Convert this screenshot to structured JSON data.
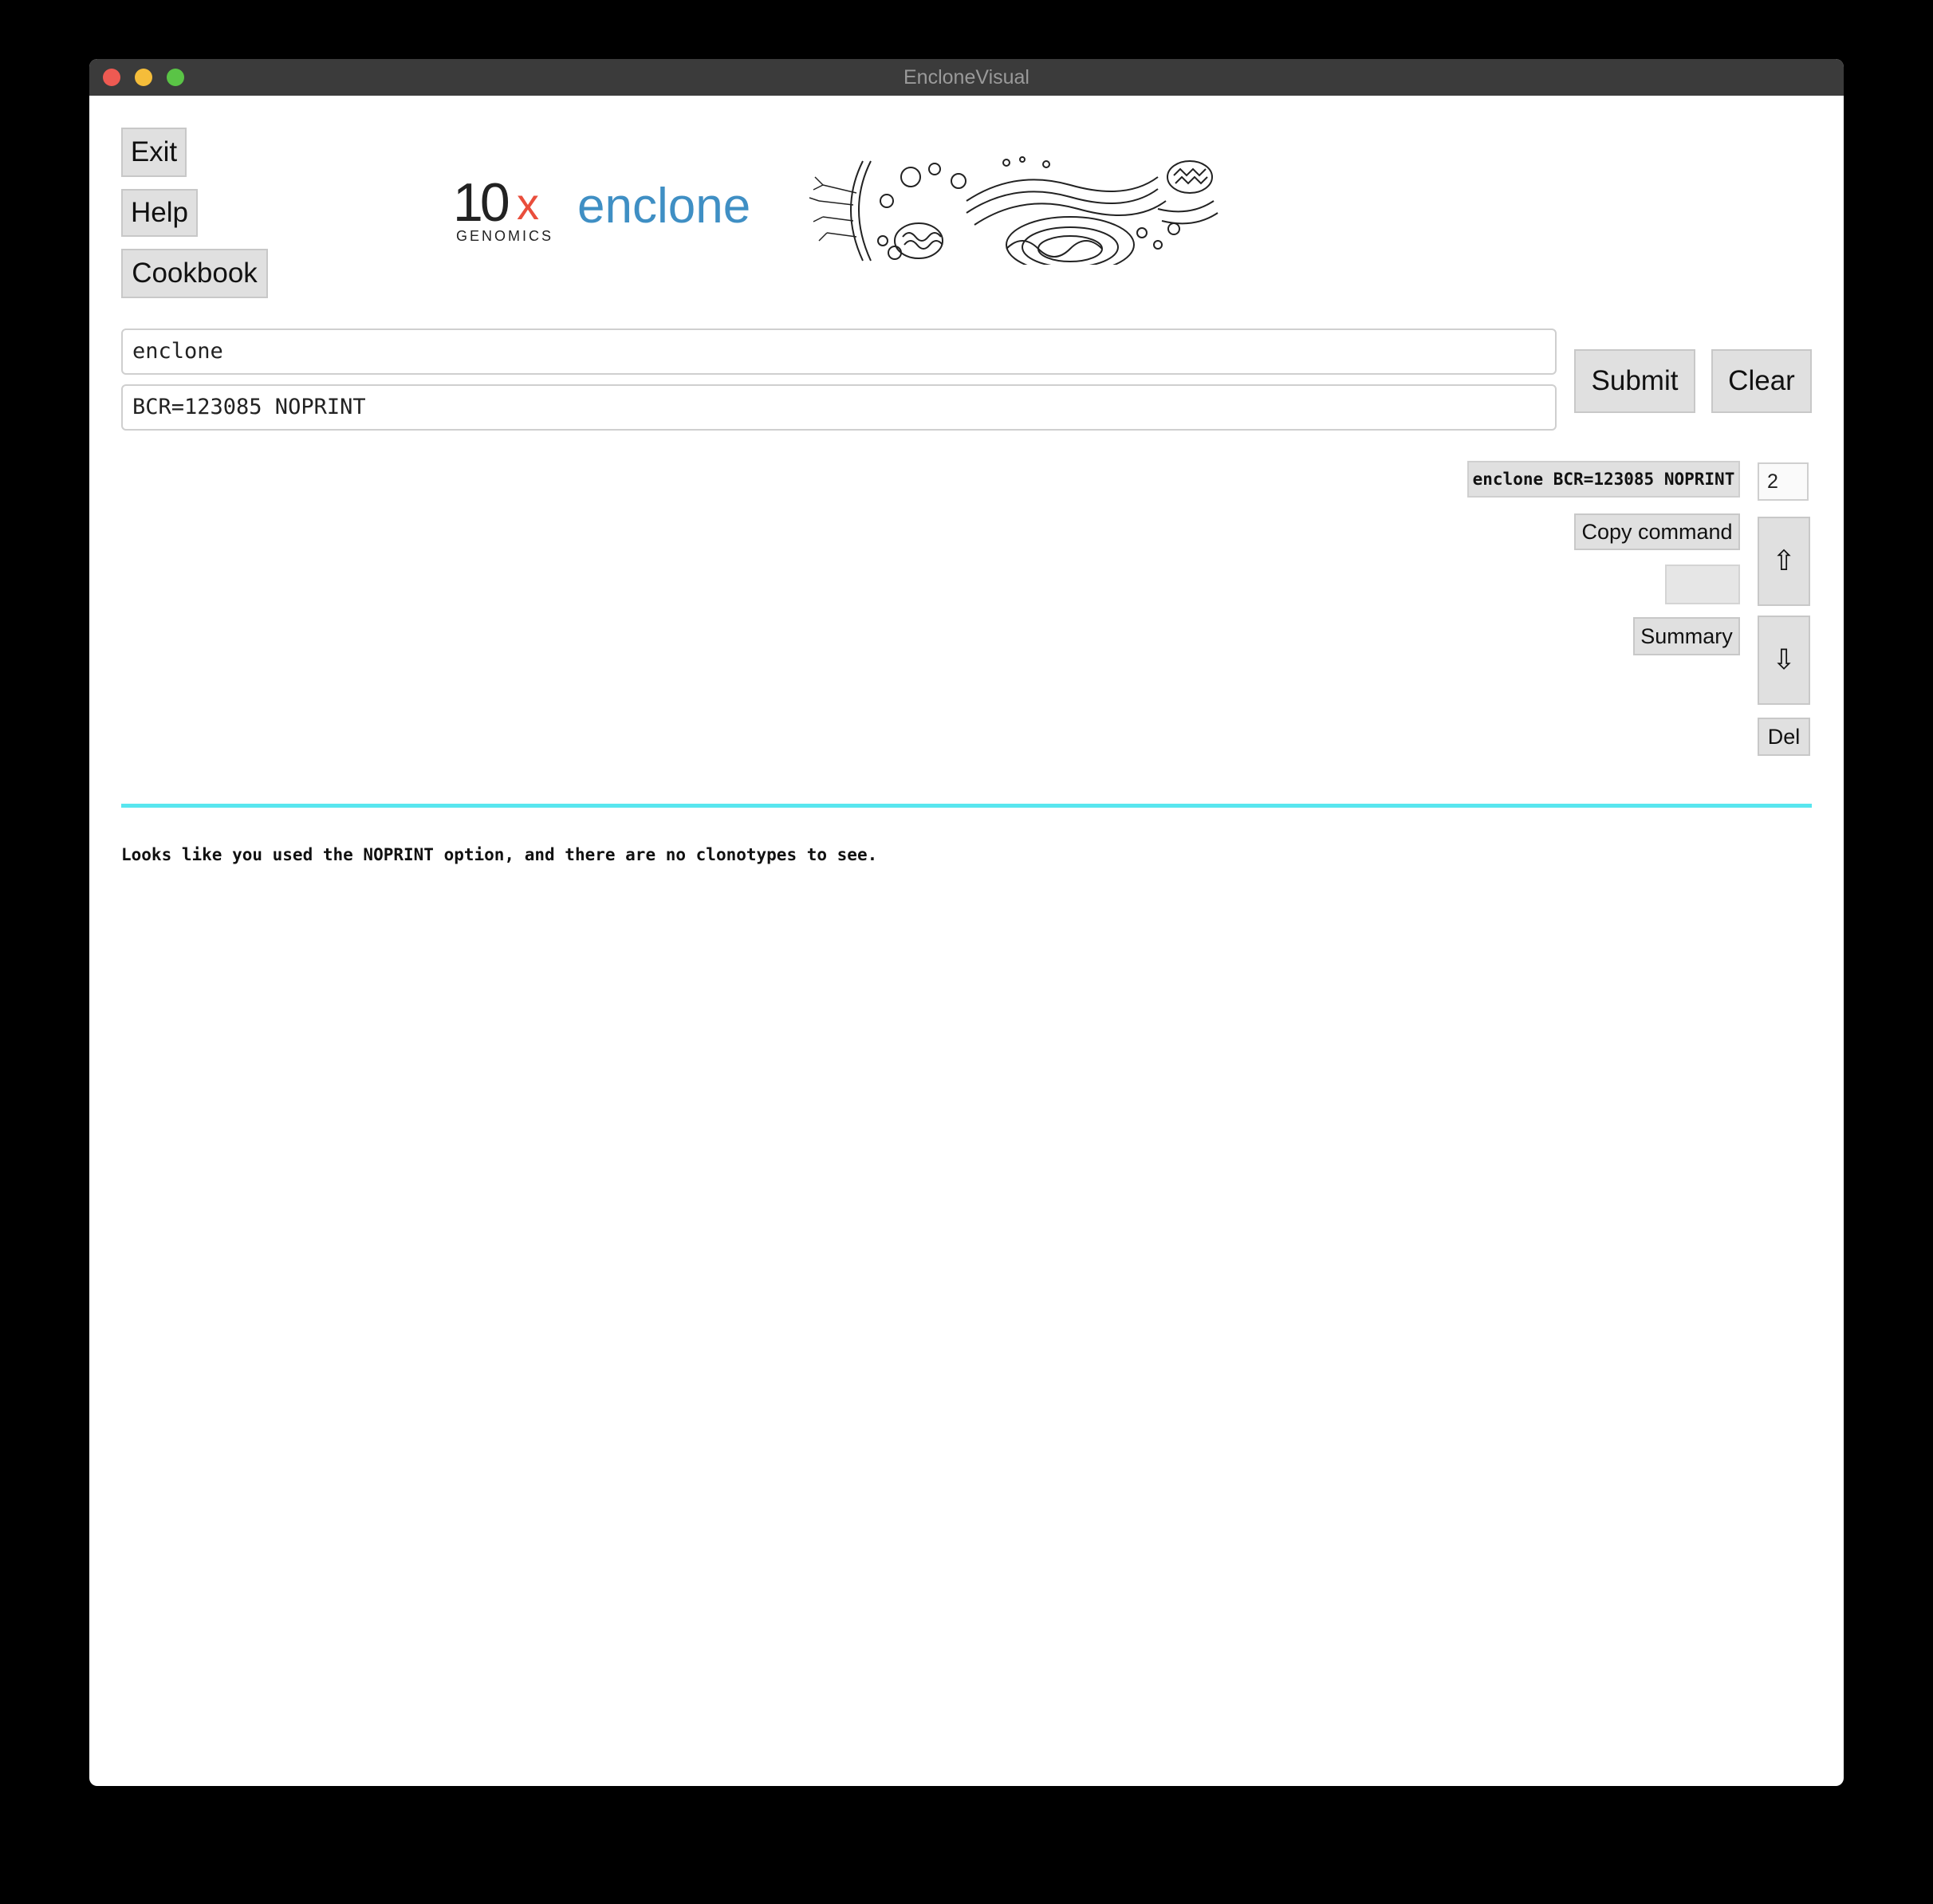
{
  "window": {
    "title": "EncloneVisual"
  },
  "buttons": {
    "exit": "Exit",
    "help": "Help",
    "cookbook": "Cookbook",
    "submit": "Submit",
    "clear": "Clear",
    "copy_command": "Copy command",
    "summary": "Summary",
    "up": "⇧",
    "down": "⇩",
    "del": "Del"
  },
  "logos": {
    "tenx_number": "10",
    "tenx_x": "x",
    "tenx_sub": "GENOMICS",
    "enclone": "enclone"
  },
  "inputs": {
    "command_name": "enclone",
    "command_args": "BCR=123085 NOPRINT"
  },
  "history": {
    "current_command": "enclone BCR=123085 NOPRINT",
    "index": "2"
  },
  "output": {
    "message": "Looks like you used the NOPRINT option, and there are no clonotypes to see."
  },
  "colors": {
    "divider": "#58e6ef",
    "enclone_logo": "#3f8fc4"
  }
}
